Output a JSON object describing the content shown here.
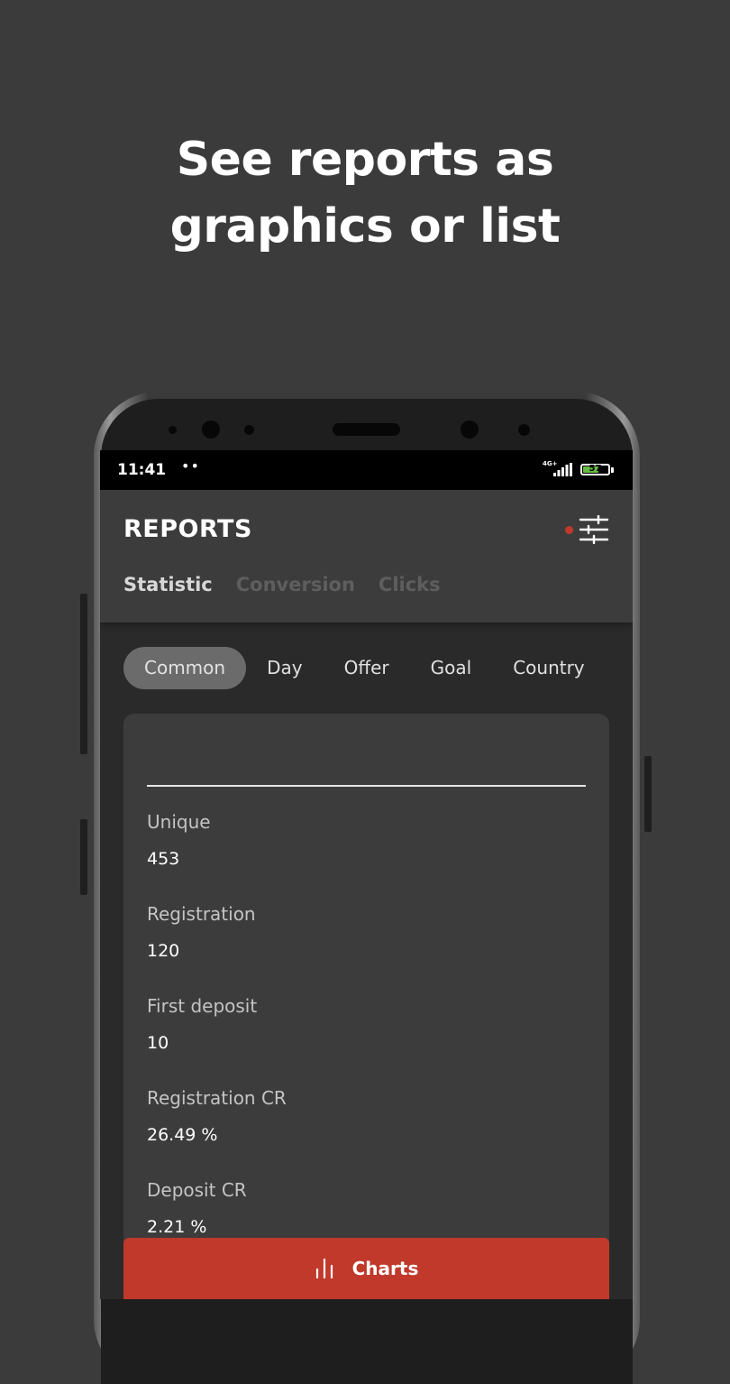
{
  "headline": {
    "line1": "See reports as",
    "line2": "graphics or list"
  },
  "status_bar": {
    "time": "11:41",
    "dots": "••",
    "network": "4G+",
    "battery": "57"
  },
  "app_bar": {
    "title": "REPORTS",
    "tabs": [
      {
        "label": "Statistic",
        "active": true
      },
      {
        "label": "Conversion",
        "active": false
      },
      {
        "label": "Clicks",
        "active": false
      }
    ]
  },
  "chips": [
    {
      "label": "Common",
      "active": true
    },
    {
      "label": "Day",
      "active": false
    },
    {
      "label": "Offer",
      "active": false
    },
    {
      "label": "Goal",
      "active": false
    },
    {
      "label": "Country",
      "active": false
    }
  ],
  "stats": [
    {
      "label": "Unique",
      "value": "453"
    },
    {
      "label": "Registration",
      "value": "120"
    },
    {
      "label": "First deposit",
      "value": "10"
    },
    {
      "label": "Registration CR",
      "value": "26.49 %"
    },
    {
      "label": "Deposit CR",
      "value": "2.21 %"
    }
  ],
  "charts_button": {
    "label": "Charts"
  },
  "colors": {
    "accent": "#c0392b",
    "background": "#3b3b3b",
    "card": "#3c3c3c",
    "filter_dot": "#c0392b",
    "battery": "#66bb44"
  }
}
